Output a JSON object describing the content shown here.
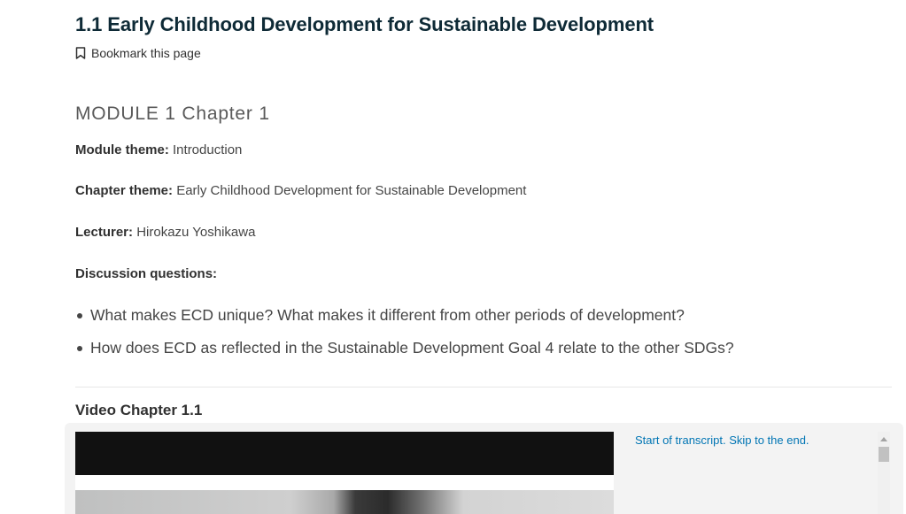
{
  "unit": {
    "title": "1.1 Early Childhood Development for Sustainable Development",
    "bookmark_label": "Bookmark this page"
  },
  "content": {
    "module_heading": "MODULE 1 Chapter 1",
    "module_theme": {
      "label": "Module theme:",
      "value": " Introduction"
    },
    "chapter_theme": {
      "label": "Chapter theme:",
      "value": " Early Childhood Development for Sustainable Development"
    },
    "lecturer": {
      "label": "Lecturer:",
      "value": " Hirokazu Yoshikawa"
    },
    "discussion_label": "Discussion questions:",
    "questions": [
      "What makes ECD unique? What makes it different from other periods of development?",
      "How does ECD as reflected in the Sustainable Development Goal 4 relate to the other SDGs?"
    ]
  },
  "video": {
    "heading": "Video Chapter 1.1",
    "transcript_link": "Start of transcript. Skip to the end."
  },
  "icons": {
    "bookmark": "bookmark-icon",
    "scroll_up": "scroll-up-arrow-icon"
  },
  "colors": {
    "title": "#0e2a36",
    "link": "#0075b4",
    "text": "#454545",
    "panel": "#f3f3f3"
  }
}
